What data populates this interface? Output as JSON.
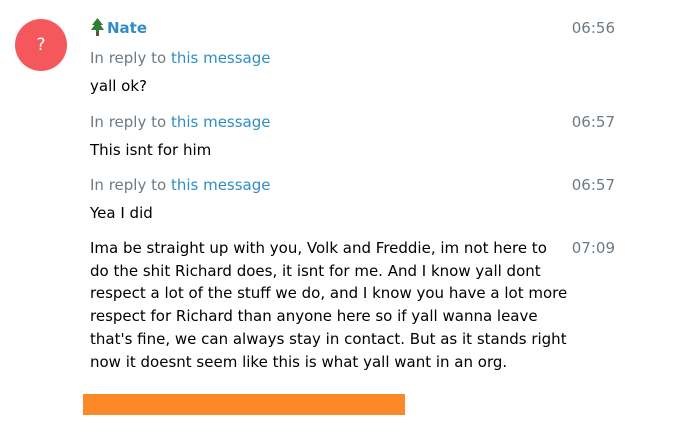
{
  "avatar": {
    "glyph": "?",
    "color": "#f5585c"
  },
  "sender": {
    "name": "Nate",
    "icon": "tree-icon",
    "color": "#2f8ec7"
  },
  "messages": [
    {
      "reply_prefix": "In reply to",
      "reply_link": "this message",
      "time": "06:56",
      "text": "yall ok?"
    },
    {
      "reply_prefix": "In reply to",
      "reply_link": "this message",
      "time": "06:57",
      "text": "This isnt for him"
    },
    {
      "reply_prefix": "In reply to",
      "reply_link": "this message",
      "time": "06:57",
      "text": "Yea I did"
    },
    {
      "time": "07:09",
      "text": "Ima be straight up with you, Volk and Freddie, im not here to do the shit Richard does, it isnt for me. And I know yall dont respect a lot of the stuff we do, and I know you have a lot more respect for Richard than anyone here so if yall wanna leave that's fine, we can always stay in contact. But as it stands right now it doesnt seem like this is what yall want in an org."
    }
  ],
  "colors": {
    "link": "#2f8ec7",
    "meta": "#6e7a84",
    "bar": "#fc8726"
  }
}
